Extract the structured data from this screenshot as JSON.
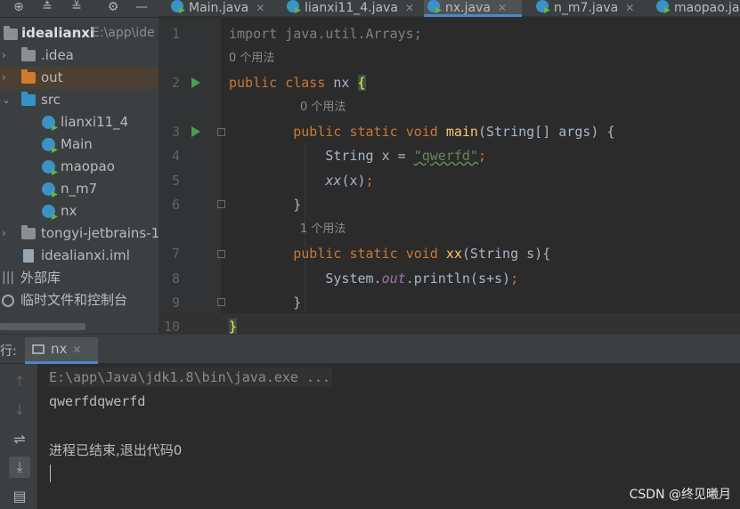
{
  "tabs": [
    {
      "label": "Main.java",
      "active": false
    },
    {
      "label": "lianxi11_4.java",
      "active": false
    },
    {
      "label": "nx.java",
      "active": true
    },
    {
      "label": "n_m7.java",
      "active": false
    },
    {
      "label": "maopao.ja",
      "active": false
    }
  ],
  "project": {
    "root_name": "idealianxi",
    "root_path": "E:\\app\\ide",
    "items": [
      {
        "label": ".idea",
        "type": "folder",
        "color": "#8c8f91"
      },
      {
        "label": "out",
        "type": "folder",
        "color": "#d07a2c"
      },
      {
        "label": "src",
        "type": "folder",
        "color": "#3592c4"
      },
      {
        "label": "lianxi11_4",
        "type": "class"
      },
      {
        "label": "Main",
        "type": "class"
      },
      {
        "label": "maopao",
        "type": "class"
      },
      {
        "label": "n_m7",
        "type": "class"
      },
      {
        "label": "nx",
        "type": "class"
      },
      {
        "label": "tongyi-jetbrains-1",
        "type": "folder",
        "color": "#8c8f91"
      },
      {
        "label": "idealianxi.iml",
        "type": "file"
      },
      {
        "label": "外部库",
        "type": "lib"
      },
      {
        "label": "临时文件和控制台",
        "type": "scratch"
      }
    ]
  },
  "editor": {
    "line_numbers": [
      "1",
      "2",
      "3",
      "4",
      "5",
      "6",
      "7",
      "8",
      "9",
      "10"
    ],
    "usage_hint_0": "0 个用法",
    "usage_hint_1": "1 个用法",
    "code": {
      "l1_import": "import java.util.Arrays;",
      "kw_public": "public",
      "kw_class": "class",
      "class_name": "nx",
      "open_brace": "{",
      "kw_static": "static",
      "kw_void": "void",
      "main_name": "main",
      "main_params": "(String[] args) {",
      "l4_decl": "String x = ",
      "l4_str": "\"qwerfd\"",
      "l4_semi": ";",
      "l5_call": "xx",
      "l5_args": "(x)",
      "close_brace": "}",
      "xx_name": "xx",
      "xx_params": "(String s){",
      "l8_sys": "System.",
      "l8_out": "out",
      "l8_rest": ".println(s+s)"
    }
  },
  "run": {
    "title": "行:",
    "tab_label": "nx",
    "console": {
      "command": "E:\\app\\Java\\jdk1.8\\bin\\java.exe ...",
      "output": "qwerfdqwerfd",
      "exit": "进程已结束,退出代码0"
    }
  },
  "watermark": "CSDN @终见曦月"
}
